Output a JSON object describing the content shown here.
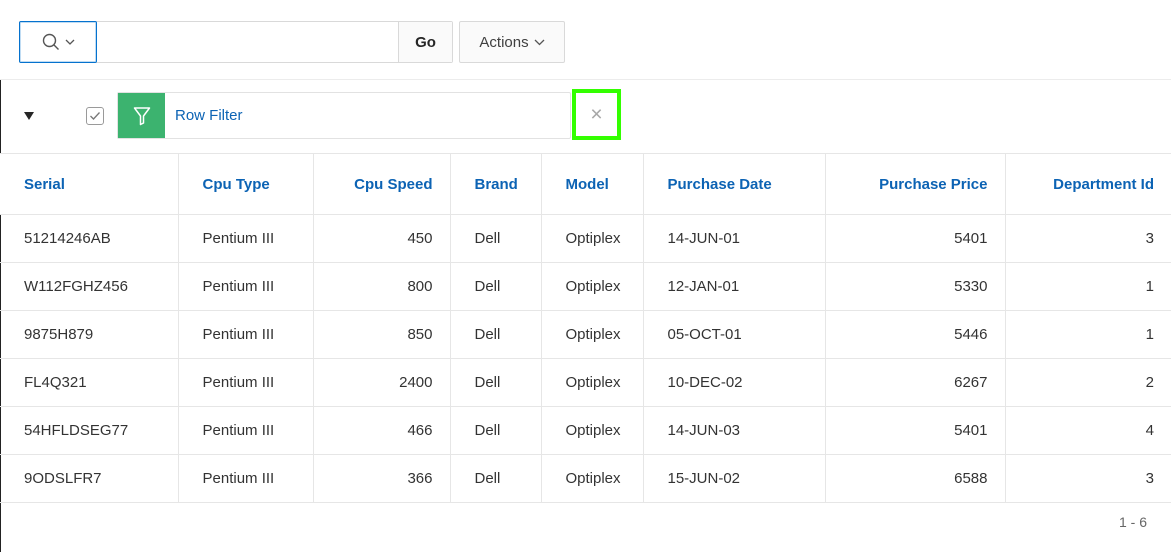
{
  "toolbar": {
    "search": {
      "value": "",
      "placeholder": ""
    },
    "go_label": "Go",
    "actions_label": "Actions"
  },
  "filter": {
    "checked": true,
    "label": "Row Filter",
    "remove_symbol": "×"
  },
  "table": {
    "columns": [
      "Serial",
      "Cpu Type",
      "Cpu Speed",
      "Brand",
      "Model",
      "Purchase Date",
      "Purchase Price",
      "Department Id"
    ],
    "rows": [
      [
        "51214246AB",
        "Pentium III",
        "450",
        "Dell",
        "Optiplex",
        "14-JUN-01",
        "5401",
        "3"
      ],
      [
        "W112FGHZ456",
        "Pentium III",
        "800",
        "Dell",
        "Optiplex",
        "12-JAN-01",
        "5330",
        "1"
      ],
      [
        "9875H879",
        "Pentium III",
        "850",
        "Dell",
        "Optiplex",
        "05-OCT-01",
        "5446",
        "1"
      ],
      [
        "FL4Q321",
        "Pentium III",
        "2400",
        "Dell",
        "Optiplex",
        "10-DEC-02",
        "6267",
        "2"
      ],
      [
        "54HFLDSEG77",
        "Pentium III",
        "466",
        "Dell",
        "Optiplex",
        "14-JUN-03",
        "5401",
        "4"
      ],
      [
        "9ODSLFR7",
        "Pentium III",
        "366",
        "Dell",
        "Optiplex",
        "15-JUN-02",
        "6588",
        "3"
      ]
    ]
  },
  "pagination": {
    "range": "1 - 6"
  },
  "colors": {
    "link_blue": "#0c63b4",
    "filter_green": "#3cb36f",
    "highlight_green": "#33ff00",
    "focus_blue": "#0572ce"
  },
  "icons": {
    "search": "search-icon",
    "chevron": "chevron-down-icon",
    "filter": "funnel-icon",
    "collapse": "triangle-down-icon",
    "close": "close-icon"
  }
}
